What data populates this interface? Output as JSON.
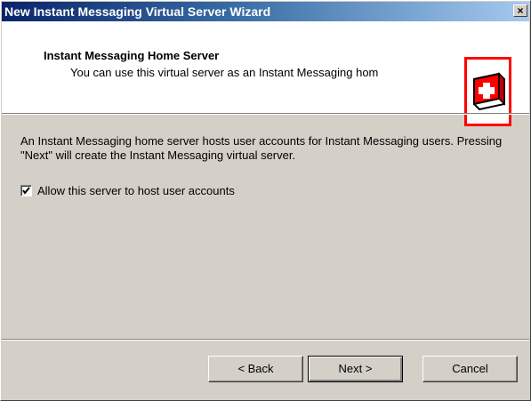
{
  "window": {
    "title": "New Instant Messaging Virtual Server Wizard",
    "close_glyph": "×"
  },
  "header": {
    "title": "Instant Messaging Home Server",
    "subtitle": "You can use this virtual server as an Instant Messaging hom",
    "logo_icon": "first-aid-kit-icon"
  },
  "body": {
    "description": "An Instant Messaging home server hosts user accounts for Instant Messaging users.  Pressing \"Next\" will create the Instant Messaging virtual server.",
    "checkbox": {
      "label": "Allow this server to host user accounts",
      "checked": true
    }
  },
  "footer": {
    "back_label": "< Back",
    "next_label": "Next >",
    "cancel_label": "Cancel"
  }
}
